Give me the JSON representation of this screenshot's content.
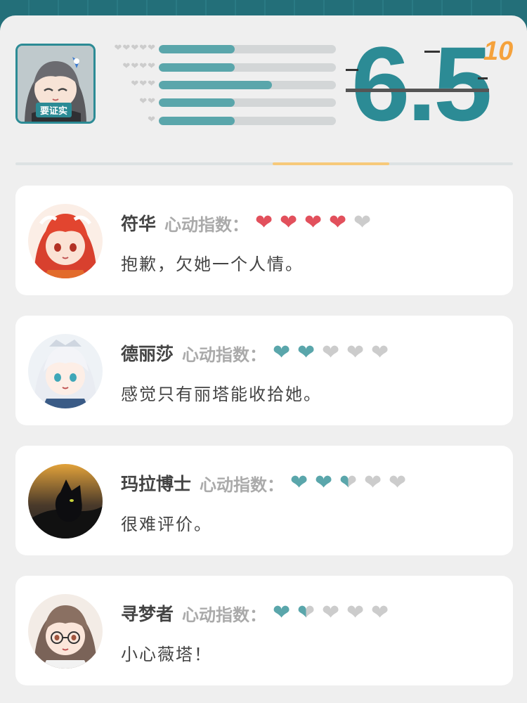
{
  "summary": {
    "avatar_tag": "要证实",
    "score": "6.5",
    "max": "10",
    "distribution": [
      {
        "hearts": "❤❤❤❤❤",
        "fraction": 0.43
      },
      {
        "hearts": "❤❤❤❤",
        "fraction": 0.43
      },
      {
        "hearts": "❤❤❤",
        "fraction": 0.64
      },
      {
        "hearts": "❤❤",
        "fraction": 0.43
      },
      {
        "hearts": "❤",
        "fraction": 0.43
      }
    ]
  },
  "colors": {
    "teal": "#5aa6ab",
    "red": "#e2505c",
    "empty": "#cccccc",
    "accent": "#f5a23c"
  },
  "cards": [
    {
      "name": "符华",
      "label": "心动指数：",
      "rating": 4,
      "heart_color": "#e2505c",
      "comment": "抱歉，欠她一个人情。",
      "avatar_icon": "fuhua-avatar-icon"
    },
    {
      "name": "德丽莎",
      "label": "心动指数：",
      "rating": 2,
      "heart_color": "#5aa6ab",
      "comment": "感觉只有丽塔能收拾她。",
      "avatar_icon": "theresa-avatar-icon"
    },
    {
      "name": "玛拉博士",
      "label": "心动指数：",
      "rating": 2.5,
      "heart_color": "#5aa6ab",
      "comment": "很难评价。",
      "avatar_icon": "black-cat-avatar-icon"
    },
    {
      "name": "寻梦者",
      "label": "心动指数：",
      "rating": 1.5,
      "heart_color": "#5aa6ab",
      "comment": "小心薇塔！",
      "avatar_icon": "dreamseeker-avatar-icon"
    }
  ]
}
